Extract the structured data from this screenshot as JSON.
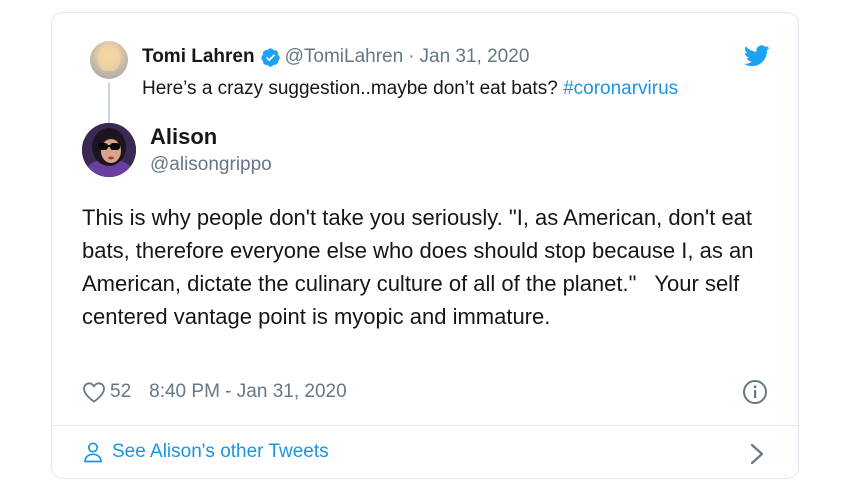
{
  "parent_tweet": {
    "name": "Tomi Lahren",
    "handle": "@TomiLahren",
    "separator": "·",
    "date": "Jan 31, 2020",
    "text": "Here’s a crazy suggestion..maybe don’t eat bats? ",
    "hashtag": "#coronarvirus",
    "avatar_icon": "profile-photo-icon",
    "verified_icon": "verified-badge-icon"
  },
  "tweet": {
    "name": "Alison",
    "handle": "@alisongrippo",
    "text": "This is why people don't take you seriously. \"I, as American, don't eat bats, therefore everyone else who does should stop because I, as an American, dictate the culinary culture of all of the planet.\"   Your self centered vantage point is myopic and immature.",
    "likes": "52",
    "timestamp": "8:40 PM - Jan 31, 2020",
    "avatar_icon": "profile-photo-icon"
  },
  "footer": {
    "link_label": "See Alison's other Tweets",
    "icon": "person-icon"
  },
  "colors": {
    "link": "#1b95e0",
    "verified": "#1da1f2",
    "secondary_text": "#657786",
    "border": "#e1e8ed"
  }
}
